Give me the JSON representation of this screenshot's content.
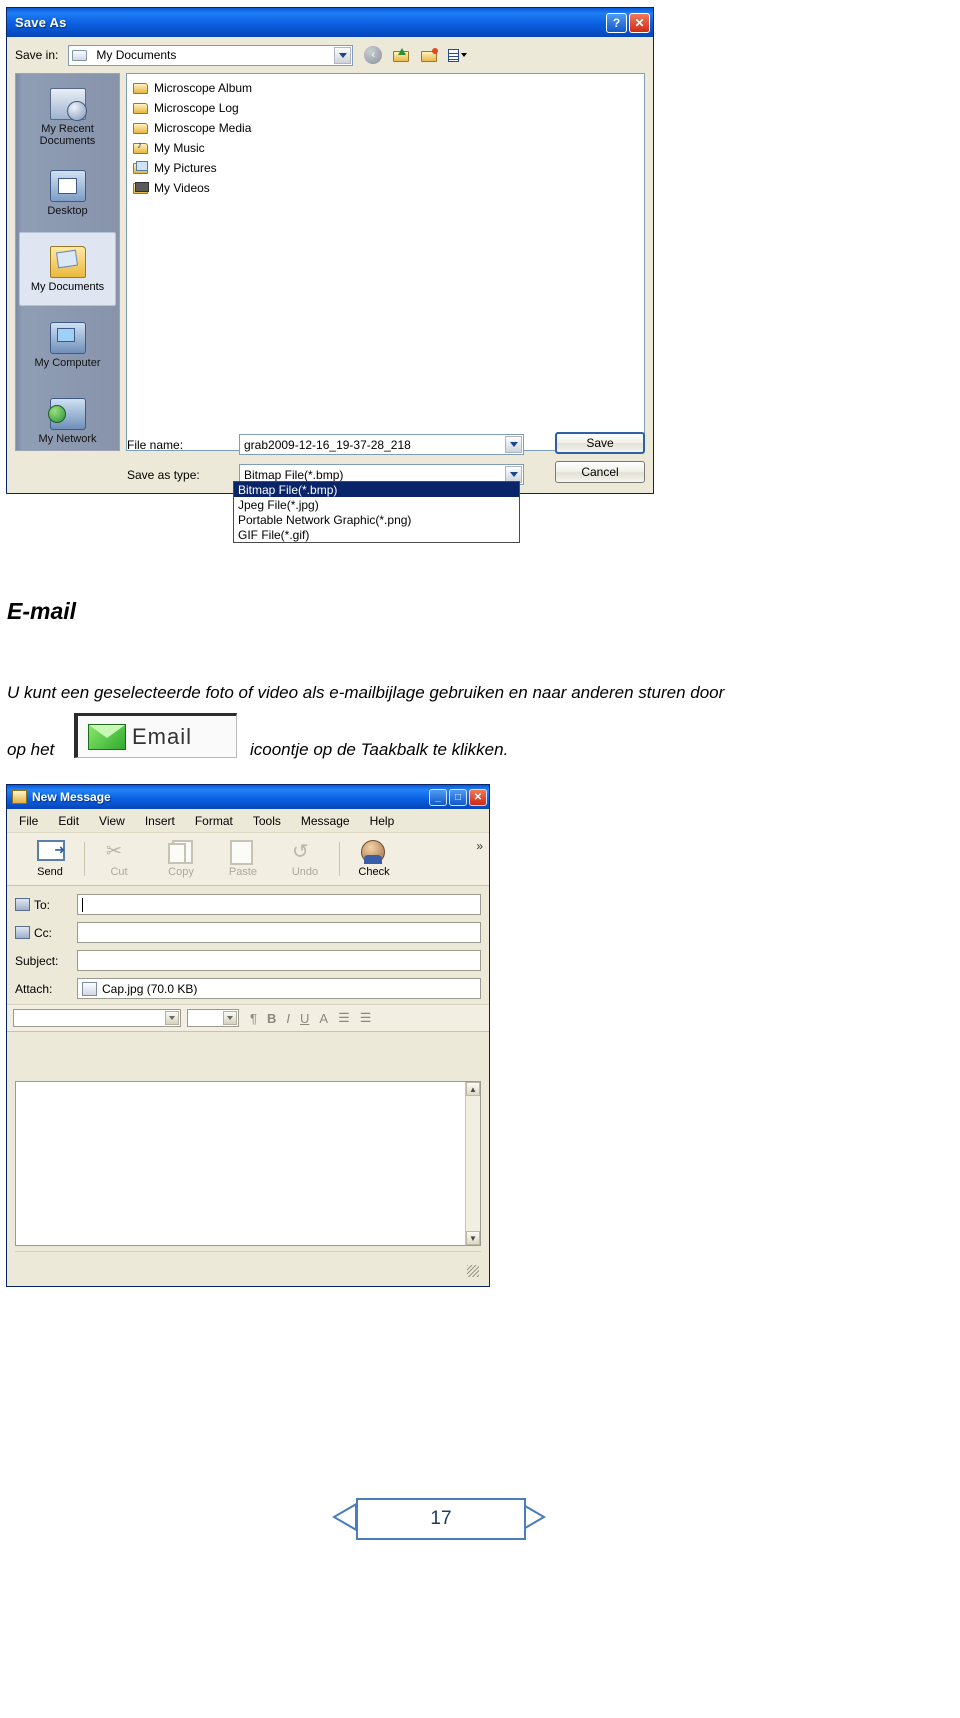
{
  "save_as_dialog": {
    "title": "Save As",
    "title_buttons": {
      "help": "?",
      "close": "✕"
    },
    "save_in": {
      "label": "Save in:",
      "value": "My Documents"
    },
    "toolbar_icons": [
      "back-icon",
      "up-one-level-icon",
      "create-new-folder-icon",
      "views-icon"
    ],
    "places": [
      {
        "label_line1": "My Recent",
        "label_line2": "Documents",
        "icon": "recent-documents-icon"
      },
      {
        "label_line1": "Desktop",
        "label_line2": "",
        "icon": "desktop-icon"
      },
      {
        "label_line1": "My Documents",
        "label_line2": "",
        "icon": "my-documents-icon"
      },
      {
        "label_line1": "My Computer",
        "label_line2": "",
        "icon": "my-computer-icon"
      },
      {
        "label_line1": "My Network",
        "label_line2": "",
        "icon": "my-network-icon"
      }
    ],
    "files": [
      {
        "name": "Microscope Album",
        "icon": "folder-icon"
      },
      {
        "name": "Microscope Log",
        "icon": "folder-icon"
      },
      {
        "name": "Microscope Media",
        "icon": "folder-icon"
      },
      {
        "name": "My Music",
        "icon": "music-folder-icon"
      },
      {
        "name": "My Pictures",
        "icon": "pictures-folder-icon"
      },
      {
        "name": "My Videos",
        "icon": "videos-folder-icon"
      }
    ],
    "file_name": {
      "label": "File name:",
      "value": "grab2009-12-16_19-37-28_218"
    },
    "save_as_type": {
      "label": "Save as type:",
      "value": "Bitmap File(*.bmp)"
    },
    "type_options": [
      "Bitmap File(*.bmp)",
      "Jpeg File(*.jpg)",
      "Portable Network Graphic(*.png)",
      "GIF File(*.gif)"
    ],
    "selected_option_index": 0,
    "buttons": {
      "save": "Save",
      "cancel": "Cancel"
    }
  },
  "document": {
    "heading": "E-mail",
    "paragraph_line1": "U kunt een geselecteerde foto of video als e-mailbijlage gebruiken en naar anderen sturen door",
    "paragraph_before_button": "op het",
    "paragraph_after_button": "icoontje op de Taakbalk te klikken.",
    "email_button_label": "Email",
    "page_number": "17"
  },
  "new_message_window": {
    "title": "New Message",
    "title_buttons": {
      "minimize": "_",
      "maximize": "□",
      "close": "✕"
    },
    "menu": [
      "File",
      "Edit",
      "View",
      "Insert",
      "Format",
      "Tools",
      "Message",
      "Help"
    ],
    "toolbar": [
      {
        "label": "Send",
        "icon": "send-icon",
        "disabled": false
      },
      {
        "label": "Cut",
        "icon": "cut-icon",
        "disabled": true
      },
      {
        "label": "Copy",
        "icon": "copy-icon",
        "disabled": true
      },
      {
        "label": "Paste",
        "icon": "paste-icon",
        "disabled": true
      },
      {
        "label": "Undo",
        "icon": "undo-icon",
        "disabled": true
      },
      {
        "label": "Check",
        "icon": "check-names-icon",
        "disabled": false
      }
    ],
    "toolbar_overflow": "»",
    "fields": {
      "to": {
        "label": "To:",
        "value": ""
      },
      "cc": {
        "label": "Cc:",
        "value": ""
      },
      "subject": {
        "label": "Subject:",
        "value": ""
      },
      "attach": {
        "label": "Attach:",
        "value": "Cap.jpg (70.0 KB)"
      }
    },
    "format_bar": {
      "font_value": "",
      "size_value": "",
      "tools": [
        "paragraph-style-icon",
        "bold-icon",
        "italic-icon",
        "underline-icon",
        "font-color-icon",
        "numbered-list-icon",
        "bullet-list-icon"
      ],
      "bold": "B",
      "italic": "I",
      "underline": "U",
      "font_color": "A"
    }
  }
}
